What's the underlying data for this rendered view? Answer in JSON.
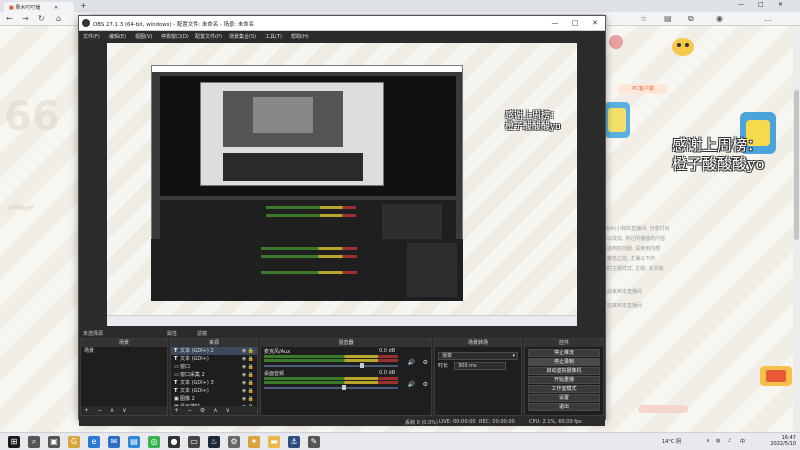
{
  "browser": {
    "tab_title": "果木叮叮锤",
    "url": "",
    "window_controls": [
      "—",
      "□",
      "✕"
    ]
  },
  "obs": {
    "title": "OBS 27.1.3 (64-bit, windows) - 配置文件: 未命名 - 场景: 未命名",
    "menu": [
      "文件(F)",
      "编辑(E)",
      "视图(V)",
      "停靠窗口(D)",
      "配置文件(P)",
      "场景集合(S)",
      "工具(T)",
      "帮助(H)"
    ],
    "dock_strip": {
      "label": "未选择源",
      "props": "属性",
      "filters": "滤镜"
    },
    "scenes": {
      "header": "场景",
      "items": [
        "场景"
      ]
    },
    "sources": {
      "header": "来源",
      "items": [
        {
          "icon": "T",
          "name": "文本 (GDI+) 2",
          "selected": true
        },
        {
          "icon": "T",
          "name": "文本 (GDI+)",
          "selected": false
        },
        {
          "icon": "▭",
          "name": "窗口",
          "selected": false
        },
        {
          "icon": "▭",
          "name": "窗口采集 2",
          "selected": false
        },
        {
          "icon": "T",
          "name": "文本 (GDI+) 3",
          "selected": false
        },
        {
          "icon": "T",
          "name": "文本 (GDI+)",
          "selected": false
        },
        {
          "icon": "▣",
          "name": "图像 2",
          "selected": false
        },
        {
          "icon": "▦",
          "name": "显示捕获",
          "selected": false
        }
      ]
    },
    "mixer": {
      "header": "混音器",
      "channels": [
        {
          "name": "麦克风/Aux",
          "db": "0.0 dB",
          "level": 0.72
        },
        {
          "name": "桌面音频",
          "db": "0.0 dB",
          "level": 0.58
        }
      ]
    },
    "transitions": {
      "header": "场景转场",
      "type": "渐变",
      "duration_label": "时长",
      "duration": "300 ms"
    },
    "controls": {
      "header": "控件",
      "buttons": [
        {
          "label": "停止推流",
          "active": false
        },
        {
          "label": "停止录制",
          "active": true
        },
        {
          "label": "启动虚拟摄像机",
          "active": false
        },
        {
          "label": "开始重播",
          "active": false
        },
        {
          "label": "工作室模式",
          "active": false
        },
        {
          "label": "设置",
          "active": false
        },
        {
          "label": "退出",
          "active": false
        }
      ]
    },
    "status": {
      "dropped": "丢帧 0 (0.0%)",
      "live": "LIVE: 00:00:00",
      "rec": "REC: 00:00:00",
      "cpu": "CPU: 2.1%, 60.00 fps"
    },
    "footer_controls": [
      "+",
      "−",
      "⚙",
      "∧",
      "∨"
    ]
  },
  "overlay": {
    "line1": "感谢上周榜：",
    "line2": "橙子酸酸酸yo"
  },
  "stream_page": {
    "snippets": [
      "PC客户端",
      "(Pink)小和的直播间, 分享付出",
      "可以改造, 将让所播放的内容",
      "不适用的功能, 请使用内部",
      "了数名之前, 主播以下的",
      "新的主题样式, 主题: 多风格",
      "欢迎来到本直播间",
      "欢迎来到本直播间"
    ]
  },
  "taskbar": {
    "weather": "14°C 阴",
    "lang": "中",
    "time": "16:47",
    "date": "2022/5/10",
    "app_icons": [
      "start-icon",
      "search-icon",
      "task-view-icon",
      "chrome-icon",
      "edge-icon",
      "mail-icon",
      "store-icon",
      "wechat-icon",
      "obs-icon",
      "terminal-icon",
      "steam-icon",
      "settings-icon",
      "game-icon",
      "folder-icon",
      "anchor-icon",
      "edit-icon"
    ]
  },
  "colors": {
    "obs_bg": "#2b2b2b",
    "panel_bg": "#1e1e1e",
    "meter_green": "#3b7a2b",
    "meter_yellow": "#b8a52a",
    "meter_red": "#9b3030",
    "overlay_text": "#ffffff"
  }
}
